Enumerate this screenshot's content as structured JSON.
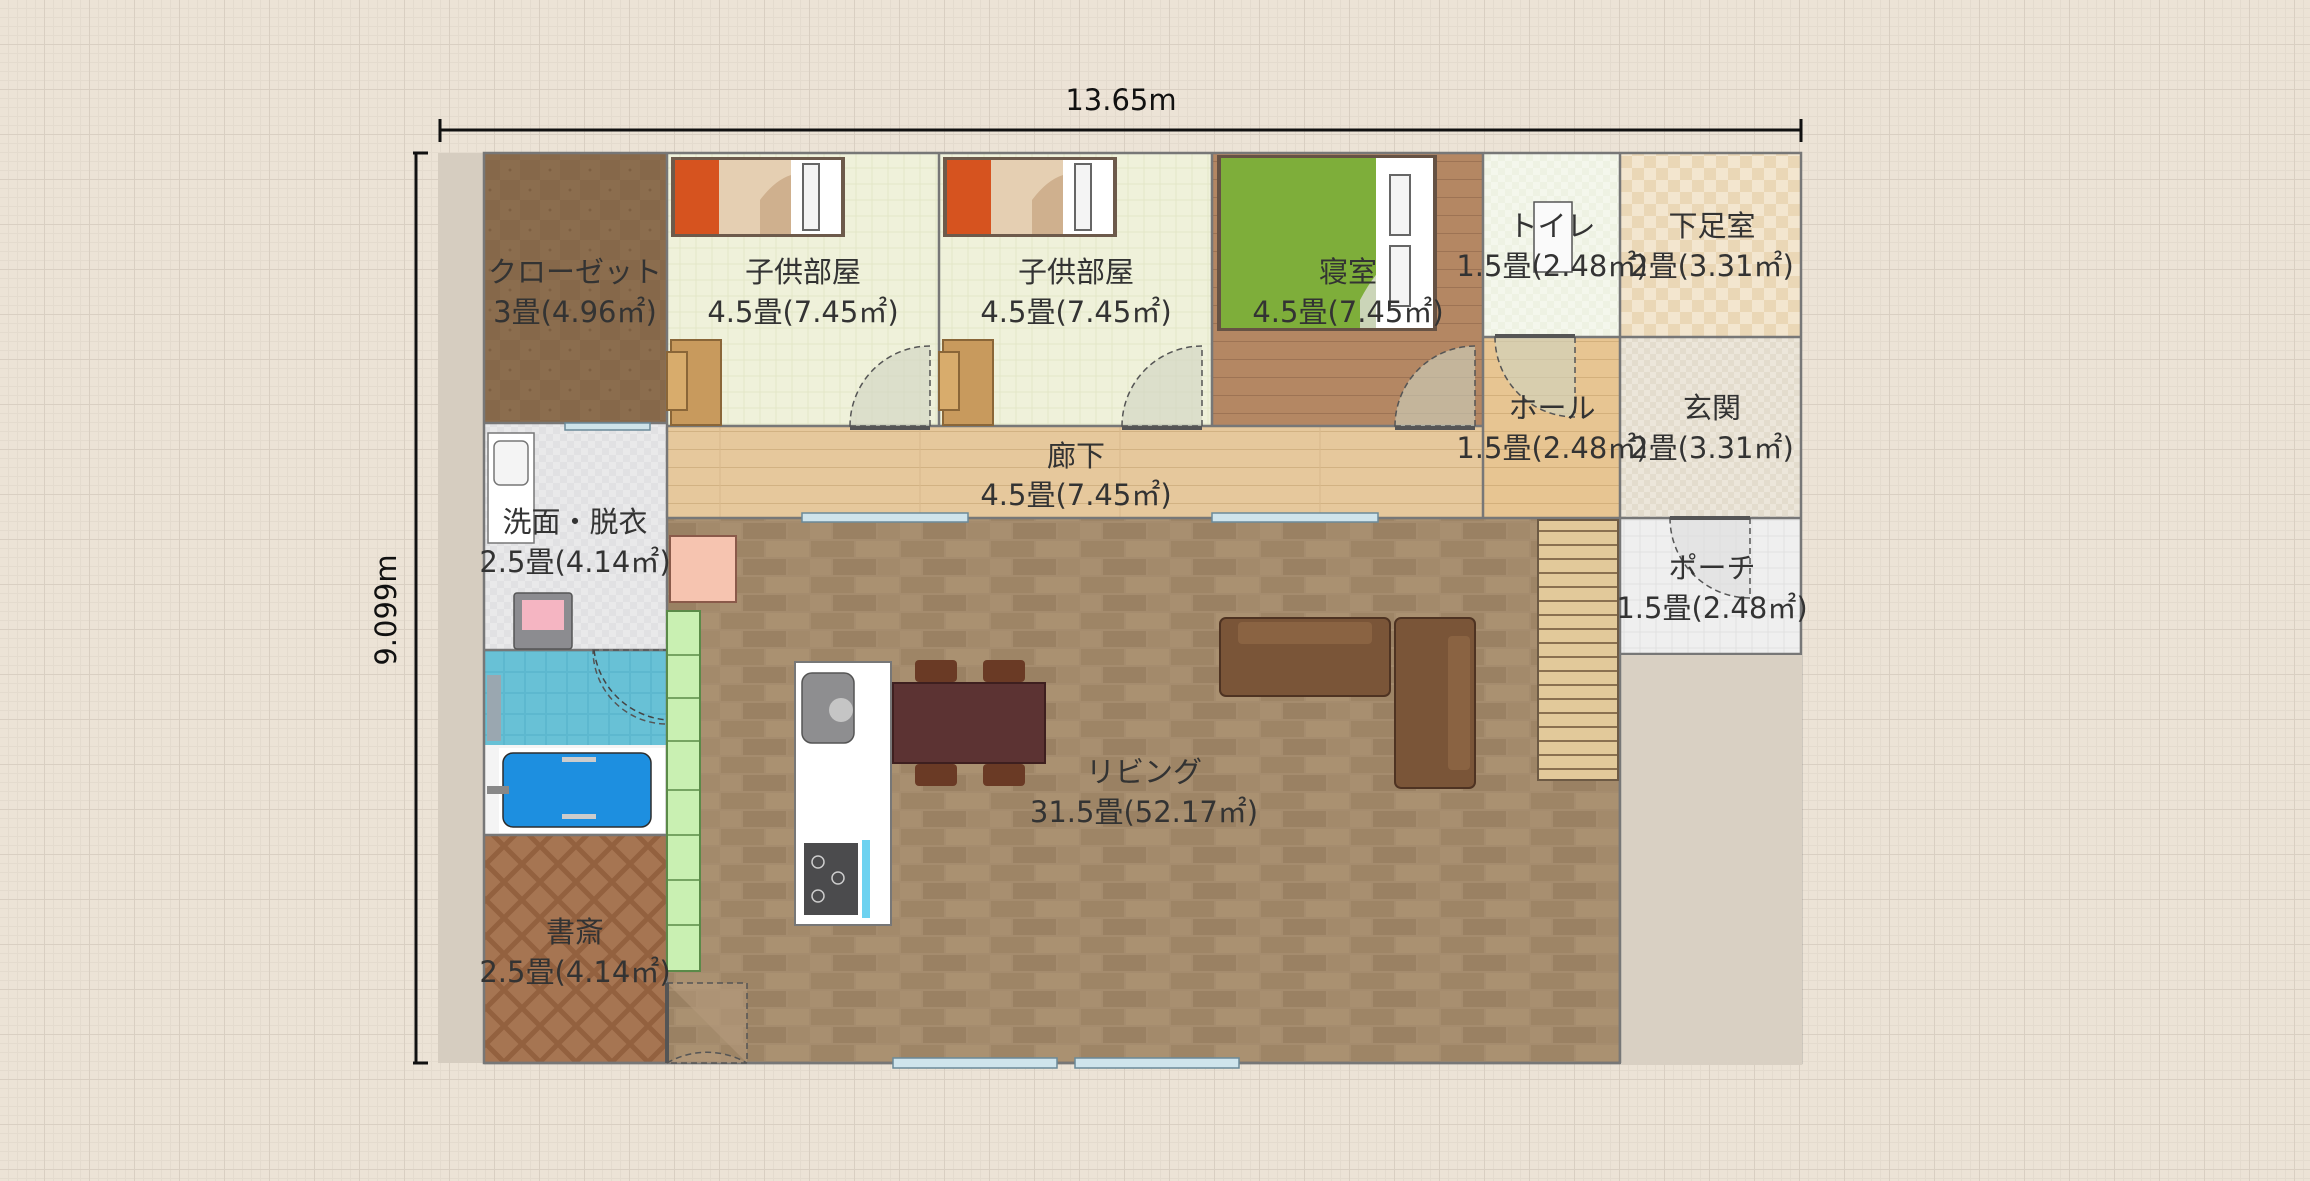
{
  "dimensions": {
    "width_label": "13.65m",
    "height_label": "9.099m"
  },
  "rooms": {
    "closet": {
      "name": "クローゼット",
      "area": "3畳(4.96㎡)"
    },
    "kids1": {
      "name": "子供部屋",
      "area": "4.5畳(7.45㎡)"
    },
    "kids2": {
      "name": "子供部屋",
      "area": "4.5畳(7.45㎡)"
    },
    "bedroom": {
      "name": "寝室",
      "area": "4.5畳(7.45㎡)"
    },
    "toilet": {
      "name": "トイレ",
      "area": "1.5畳(2.48㎡)"
    },
    "shoeroom": {
      "name": "下足室",
      "area": "2畳(3.31㎡)"
    },
    "hall": {
      "name": "ホール",
      "area": "1.5畳(2.48㎡)"
    },
    "entrance": {
      "name": "玄関",
      "area": "2畳(3.31㎡)"
    },
    "corridor": {
      "name": "廊下",
      "area": "4.5畳(7.45㎡)"
    },
    "washroom": {
      "name": "洗面・脱衣",
      "area": "2.5畳(4.14㎡)"
    },
    "porch": {
      "name": "ポーチ",
      "area": "1.5畳(2.48㎡)"
    },
    "living": {
      "name": "リビング",
      "area": "31.5畳(52.17㎡)"
    },
    "study": {
      "name": "書斎",
      "area": "2.5畳(4.14㎡)"
    }
  },
  "colors": {
    "grid_background": "#ece3d6",
    "wall": "#7a7a7a",
    "living_floor": "#a38a6c",
    "corridor_floor": "#e3c69a",
    "closet_floor": "#8a6a4a",
    "kids_floor": "#eef0d8",
    "bath_tile": "#57b7cf",
    "bathtub": "#1e8fe0",
    "bed_green": "#7aad3a",
    "bed_orange": "#d8541e"
  }
}
